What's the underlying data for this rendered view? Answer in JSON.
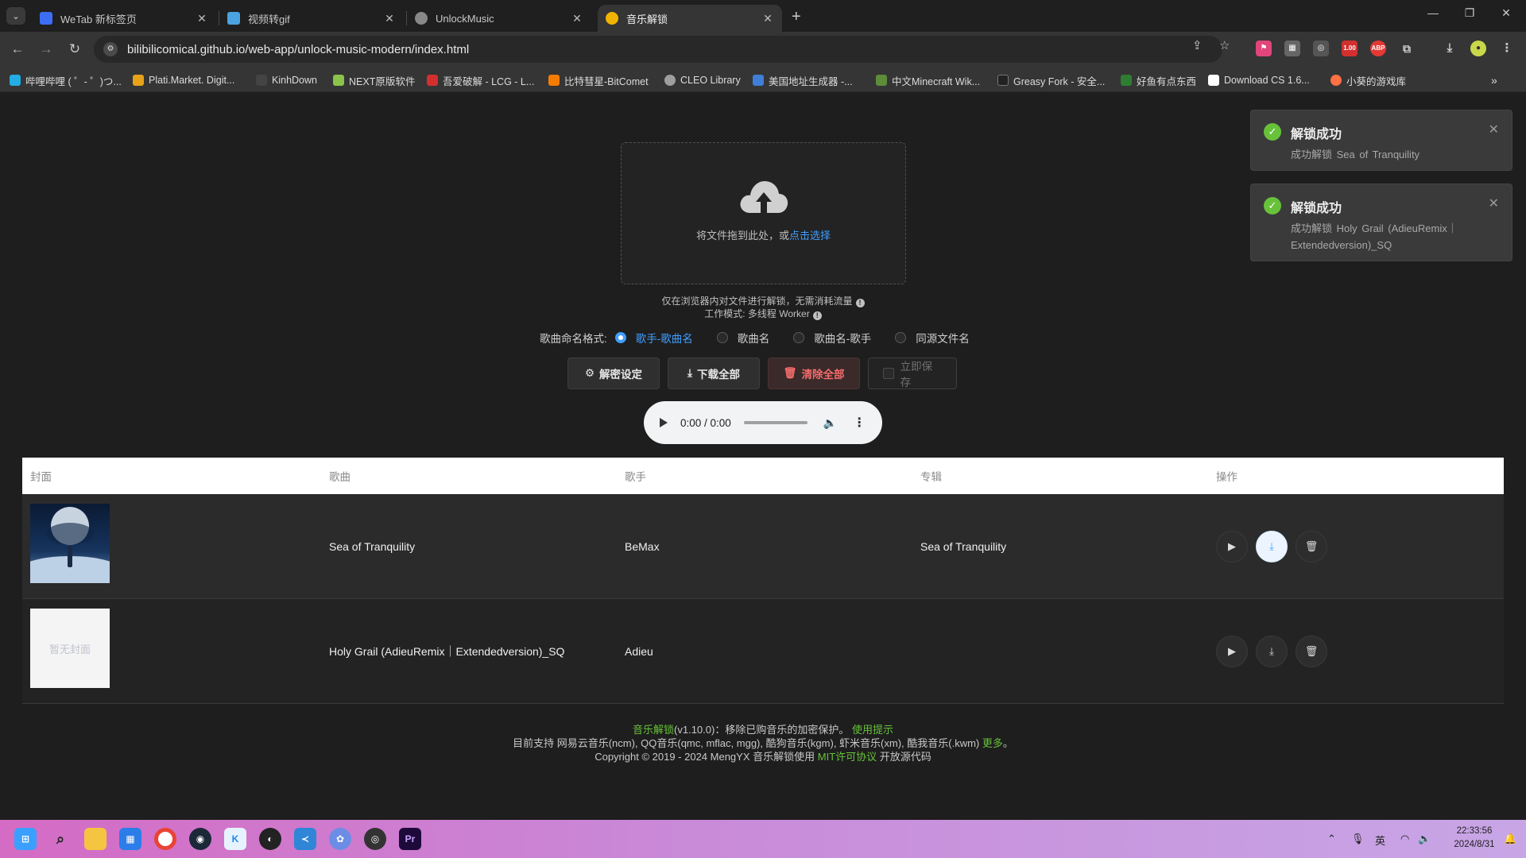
{
  "browser": {
    "tabs": [
      {
        "title": "WeTab 新标签页",
        "icon": "wetab-icon",
        "color": "#3b6ef5",
        "active": false
      },
      {
        "title": "视频转gif",
        "icon": "gif-icon",
        "color": "#4aa3e0",
        "active": false
      },
      {
        "title": "UnlockMusic",
        "icon": "globe-icon",
        "color": "#888888",
        "active": false
      },
      {
        "title": "音乐解锁",
        "icon": "music-unlock-icon",
        "color": "#f0b400",
        "active": true
      }
    ],
    "url": "bilibilicomical.github.io/web-app/unlock-music-modern/index.html",
    "extensions": [
      "1.00",
      "ABP"
    ],
    "bookmarks": [
      {
        "label": "哔哩哔哩 ( ゜- ゜)つ...",
        "color": "#23ade5"
      },
      {
        "label": "Plati.Market. Digit...",
        "color": "#e7a21a"
      },
      {
        "label": "KinhDown",
        "color": "#444444"
      },
      {
        "label": "NEXT原版软件",
        "color": "#8bc34a"
      },
      {
        "label": "吾爱破解 - LCG - L...",
        "color": "#d32f2f"
      },
      {
        "label": "比特彗星-BitComet",
        "color": "#f57c00"
      },
      {
        "label": "CLEO Library",
        "color": "#9e9e9e"
      },
      {
        "label": "美国地址生成器 -...",
        "color": "#3f7fd8"
      },
      {
        "label": "中文Minecraft Wik...",
        "color": "#5d8c3a"
      },
      {
        "label": "Greasy Fork - 安全...",
        "color": "#222222"
      },
      {
        "label": "好鱼有点东西",
        "color": "#2e7d32"
      },
      {
        "label": "Download CS 1.6...",
        "color": "#ffffff"
      },
      {
        "label": "小葵的游戏库",
        "color": "#ff7043"
      }
    ]
  },
  "upload": {
    "text": "将文件拖到此处，或",
    "link": "点击选择"
  },
  "hints": {
    "line1": "仅在浏览器内对文件进行解锁，无需消耗流量",
    "line2": "工作模式: 多线程 Worker"
  },
  "naming": {
    "label": "歌曲命名格式:",
    "options": [
      "歌手-歌曲名",
      "歌曲名",
      "歌曲名-歌手",
      "同源文件名"
    ],
    "selected": 0
  },
  "buttons": {
    "settings": "解密设定",
    "download_all": "下载全部",
    "clear_all": "清除全部",
    "save_now": "立即保存"
  },
  "player": {
    "time": "0:00 / 0:00"
  },
  "table": {
    "headers": [
      "封面",
      "歌曲",
      "歌手",
      "专辑",
      "操作"
    ],
    "rows": [
      {
        "cover": "moon-cover",
        "title": "Sea of Tranquility",
        "artist": "BeMax",
        "album": "Sea of Tranquility"
      },
      {
        "cover": "暂无封面",
        "title": "Holy Grail (AdieuRemix｜Extendedversion)_SQ",
        "artist": "Adieu",
        "album": ""
      }
    ]
  },
  "footer": {
    "app_link": "音乐解锁",
    "version": "(v1.10.0)：移除已购音乐的加密保护。",
    "usage_link": "使用提示",
    "support": "目前支持 网易云音乐(ncm), QQ音乐(qmc, mflac, mgg), 酷狗音乐(kgm), 虾米音乐(xm), 酷我音乐(.kwm)",
    "more_link": "更多",
    "more_suffix": "。",
    "copyright": "Copyright © 2019 - 2024 MengYX 音乐解锁使用",
    "license_link": "MIT许可协议",
    "open_source": "开放源代码"
  },
  "toasts": [
    {
      "title": "解锁成功",
      "message": "成功解锁 Sea of Tranquility"
    },
    {
      "title": "解锁成功",
      "message": "成功解锁 Holy Grail (AdieuRemix｜Extendedversion)_SQ"
    }
  ],
  "taskbar": {
    "ime": "英",
    "time": "22:33:56",
    "date": "2024/8/31"
  },
  "colors": {
    "accent": "#409eff",
    "success": "#67c23a",
    "danger": "#f56c6c"
  }
}
